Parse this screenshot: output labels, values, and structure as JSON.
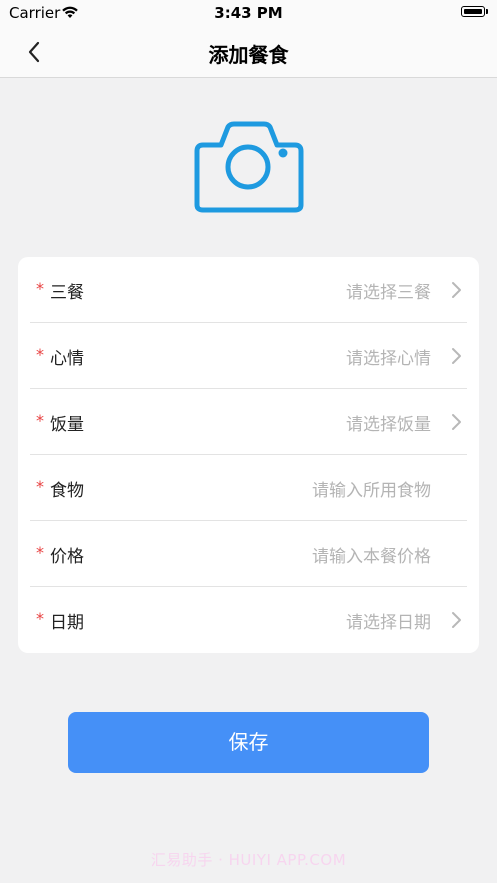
{
  "status_bar": {
    "carrier": "Carrier",
    "time": "3:43 PM"
  },
  "nav": {
    "title": "添加餐食",
    "back_icon": "chevron-left-icon"
  },
  "camera": {
    "icon": "camera-icon",
    "color": "#1e9ae0"
  },
  "form": {
    "required_mark": "*",
    "rows": [
      {
        "label": "三餐",
        "value": "请选择三餐",
        "type": "select"
      },
      {
        "label": "心情",
        "value": "请选择心情",
        "type": "select"
      },
      {
        "label": "饭量",
        "value": "请选择饭量",
        "type": "select"
      },
      {
        "label": "食物",
        "value": "请输入所用食物",
        "type": "input"
      },
      {
        "label": "价格",
        "value": "请输入本餐价格",
        "type": "input"
      },
      {
        "label": "日期",
        "value": "请选择日期",
        "type": "select"
      }
    ]
  },
  "save_button": {
    "label": "保存",
    "color": "#4590f7"
  },
  "watermark": "汇易助手 · HUIYI APP.COM",
  "colors": {
    "required": "#e84040",
    "placeholder": "#b4b4b4",
    "background": "#f1f1f2"
  }
}
